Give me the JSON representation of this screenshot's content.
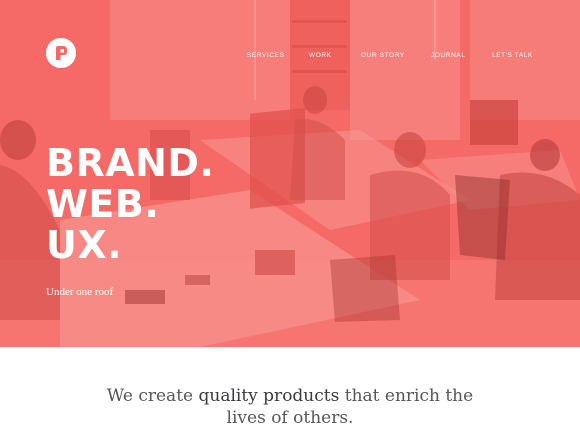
{
  "nav": {
    "items": [
      "SERVICES",
      "WORK",
      "OUR STORY",
      "JOURNAL",
      "LET'S TALK"
    ]
  },
  "hero": {
    "lines": [
      "BRAND.",
      "WEB.",
      "UX."
    ],
    "tagline": "Under one roof",
    "overlay_color": "#f56863"
  },
  "mission": {
    "before": "We create ",
    "emphasis": "quality products",
    "after_line1": " that enrich the",
    "line2": "lives of others."
  },
  "icons": {
    "logo": "brand-logo-icon"
  }
}
